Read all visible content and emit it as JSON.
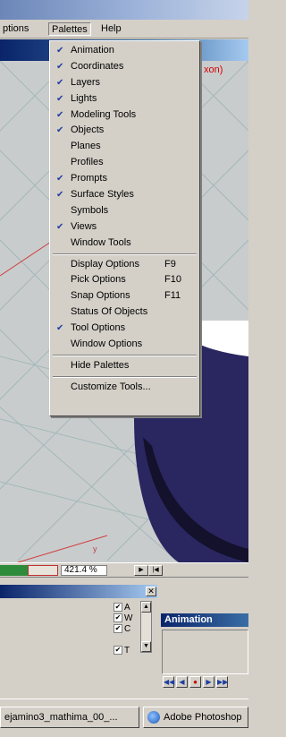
{
  "menubar": {
    "options_label": "ptions",
    "palettes_label": "Palettes",
    "help_label": "Help"
  },
  "viewport": {
    "view_label": "xon)",
    "cursor_label": "y"
  },
  "palettes_menu": {
    "groups": [
      [
        {
          "label": "Animation",
          "checked": true
        },
        {
          "label": "Coordinates",
          "checked": true
        },
        {
          "label": "Layers",
          "checked": true
        },
        {
          "label": "Lights",
          "checked": true
        },
        {
          "label": "Modeling Tools",
          "checked": true
        },
        {
          "label": "Objects",
          "checked": true
        },
        {
          "label": "Planes",
          "checked": false
        },
        {
          "label": "Profiles",
          "checked": false
        },
        {
          "label": "Prompts",
          "checked": true
        },
        {
          "label": "Surface Styles",
          "checked": true
        },
        {
          "label": "Symbols",
          "checked": false
        },
        {
          "label": "Views",
          "checked": true
        },
        {
          "label": "Window Tools",
          "checked": false
        }
      ],
      [
        {
          "label": "Display Options",
          "checked": false,
          "shortcut": "F9"
        },
        {
          "label": "Pick Options",
          "checked": false,
          "shortcut": "F10"
        },
        {
          "label": "Snap Options",
          "checked": false,
          "shortcut": "F11"
        },
        {
          "label": "Status Of Objects",
          "checked": false
        },
        {
          "label": "Tool Options",
          "checked": true
        },
        {
          "label": "Window Options",
          "checked": false
        }
      ],
      [
        {
          "label": "Hide Palettes",
          "checked": false
        }
      ],
      [
        {
          "label": "Customize Tools...",
          "checked": false
        }
      ]
    ],
    "check_glyph": "✔"
  },
  "statusbar": {
    "zoom": "421.4 %",
    "play_icon": "▶",
    "step_icon": "|◀"
  },
  "left_panel": {
    "close_glyph": "✕",
    "toggles": [
      {
        "label": "A",
        "checked": true
      },
      {
        "label": "W",
        "checked": true
      },
      {
        "label": "C",
        "checked": true
      },
      {
        "label": "T",
        "checked": true
      }
    ]
  },
  "animation_panel": {
    "title": "Animation",
    "controls": [
      {
        "name": "rewind-icon",
        "glyph": "◀◀"
      },
      {
        "name": "step-back-icon",
        "glyph": "◀"
      },
      {
        "name": "record-icon",
        "glyph": "●"
      },
      {
        "name": "step-forward-icon",
        "glyph": "▶"
      },
      {
        "name": "fast-forward-icon",
        "glyph": "▶▶"
      }
    ]
  },
  "taskbar": {
    "items": [
      {
        "label": "ejamino3_mathima_00_..."
      },
      {
        "label": "Adobe Photoshop"
      }
    ]
  },
  "colors": {
    "check_color": "#1e3fa0",
    "record_color": "#c00000",
    "shape_color": "#2a2660"
  }
}
